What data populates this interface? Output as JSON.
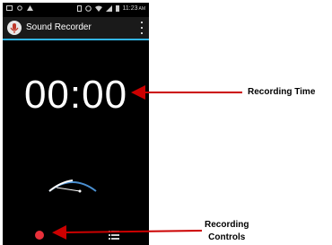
{
  "status_bar": {
    "time": "11:23",
    "am_pm": "AM"
  },
  "action_bar": {
    "title": "Sound Recorder"
  },
  "timer": {
    "value": "00:00"
  },
  "annotations": {
    "recording_time": "Recording Time",
    "recording_controls_line1": "Recording",
    "recording_controls_line2": "Controls"
  },
  "colors": {
    "accent": "#33b5e5",
    "record": "#e8303a",
    "arrow": "#cc0000"
  },
  "icons": {
    "app": "microphone-icon",
    "record": "record-icon",
    "list": "list-icon",
    "menu": "overflow-menu-icon"
  }
}
